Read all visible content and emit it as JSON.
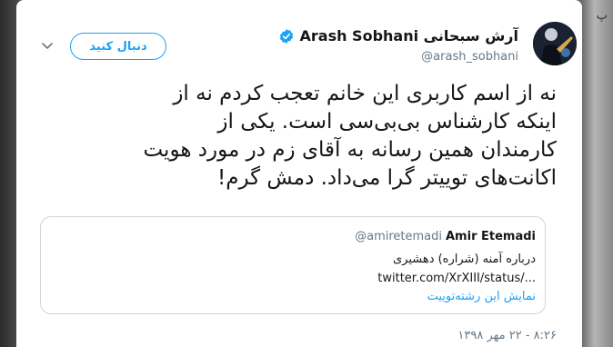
{
  "backdrop": {
    "right_peek_text": "پ"
  },
  "tweet": {
    "display_name": "Arash Sobhani آرش سبحانی",
    "handle": "@arash_sobhani",
    "verified": true,
    "follow_button_label": "دنبال کنید",
    "text_lines": [
      "نه از اسم کاربری این خانم تعجب کردم نه از",
      "اینکه کارشناس بی‌بی‌سی است. یکی از",
      "کارمندان همین رسانه به آقای زم در مورد هویت",
      "اکانت‌های توییتر گرا می‌داد. دمش گرم!"
    ],
    "quoted": {
      "name": "Amir Etemadi",
      "handle": "@amiretemadi",
      "text": "درباره آمنه (شراره) دهشیری",
      "link": "twitter.com/XrXIII/status/...",
      "show_thread": "نمایش این رشته‌توییت"
    },
    "timestamp": "۸:۲۶ - ۲۲ مهر ۱۳۹۸"
  },
  "colors": {
    "accent": "#1da1f2",
    "text_primary": "#14171a",
    "text_secondary": "#657786",
    "border": "#ccd6dd"
  },
  "icons": {
    "verified": "verified-badge-icon",
    "caret": "chevron-down-icon",
    "avatar": "user-avatar"
  }
}
